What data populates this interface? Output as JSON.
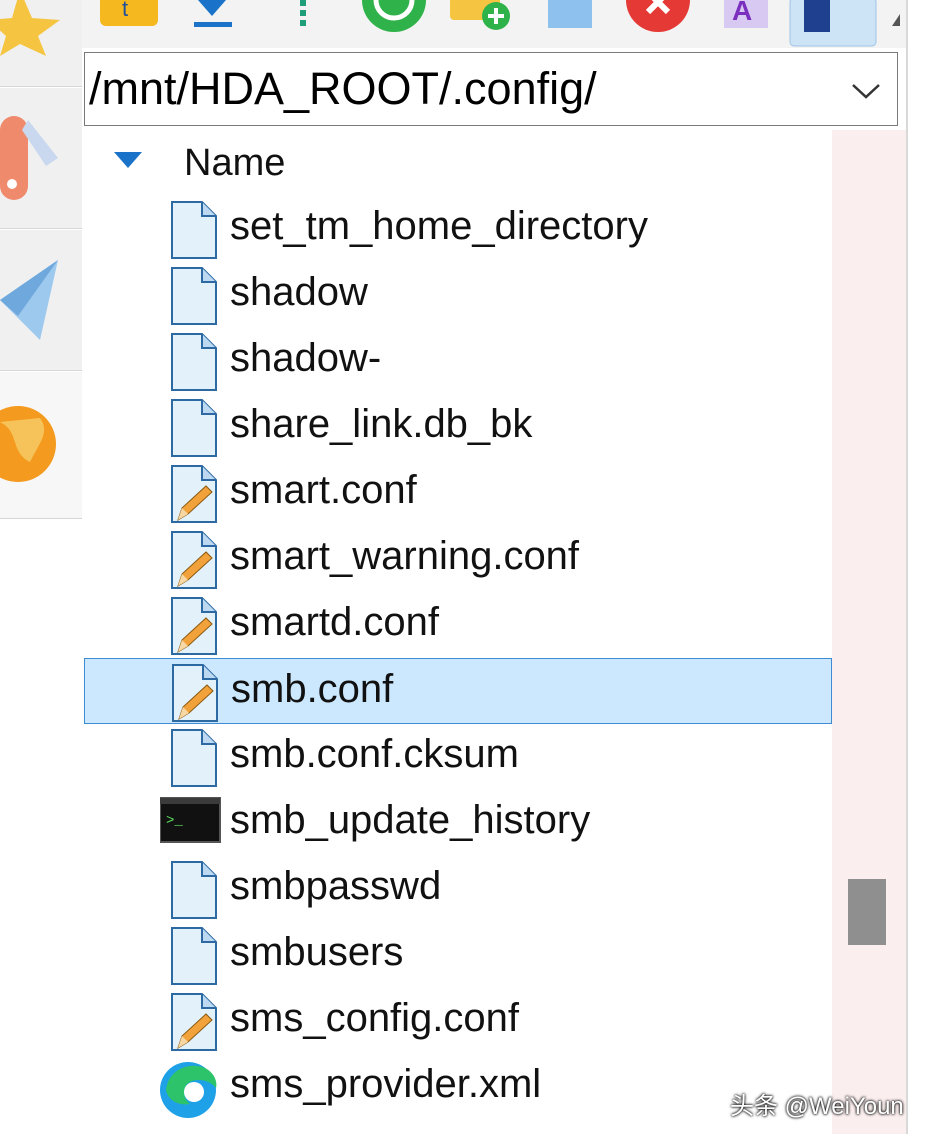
{
  "path_bar": {
    "path": "/mnt/HDA_ROOT/.config/"
  },
  "list": {
    "header": {
      "name_label": "Name"
    },
    "rows": [
      {
        "name": "set_tm_home_directory",
        "icon": "file-icon"
      },
      {
        "name": "shadow",
        "icon": "file-icon"
      },
      {
        "name": "shadow-",
        "icon": "file-icon"
      },
      {
        "name": "share_link.db_bk",
        "icon": "file-icon"
      },
      {
        "name": "smart.conf",
        "icon": "config-file-icon"
      },
      {
        "name": "smart_warning.conf",
        "icon": "config-file-icon"
      },
      {
        "name": "smartd.conf",
        "icon": "config-file-icon"
      },
      {
        "name": "smb.conf",
        "icon": "config-file-icon",
        "selected": true
      },
      {
        "name": "smb.conf.cksum",
        "icon": "file-icon"
      },
      {
        "name": "smb_update_history",
        "icon": "terminal-icon"
      },
      {
        "name": "smbpasswd",
        "icon": "file-icon"
      },
      {
        "name": "smbusers",
        "icon": "file-icon"
      },
      {
        "name": "sms_config.conf",
        "icon": "config-file-icon"
      },
      {
        "name": "sms_provider.xml",
        "icon": "edge-browser-icon"
      }
    ]
  },
  "watermark": "头条 @WeiYoun",
  "colors": {
    "selection_bg": "#cce8ff",
    "selection_border": "#3f8ad2",
    "file_icon_fill": "#e3f1fb",
    "file_icon_stroke": "#2d6aa3"
  }
}
